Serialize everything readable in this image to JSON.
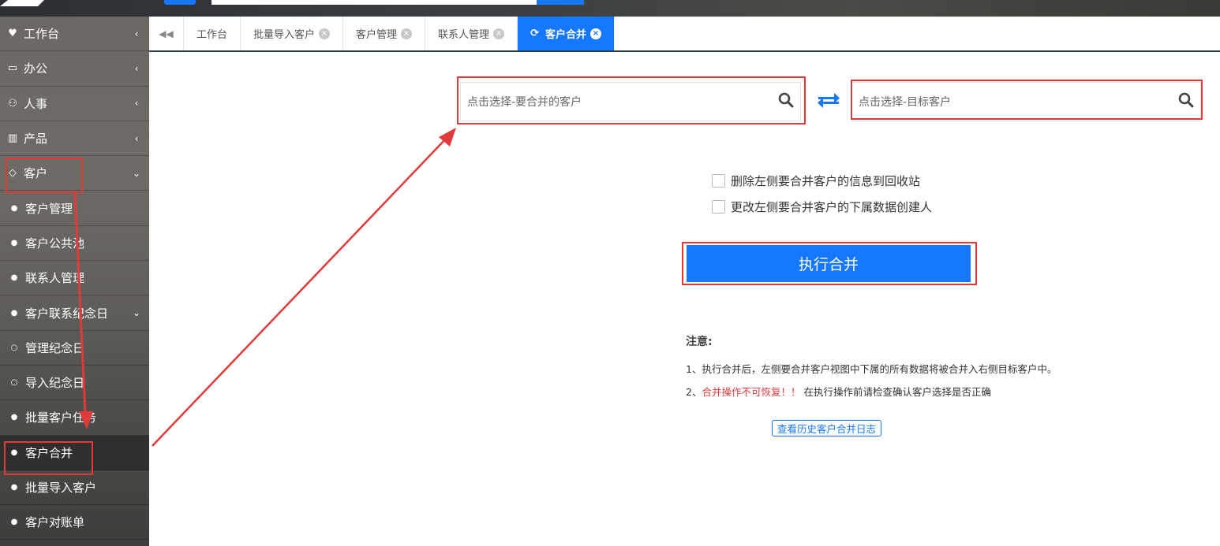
{
  "sidebar": {
    "items": [
      {
        "icon": "heart-icon",
        "glyph": "♥",
        "label": "工作台",
        "chev": "‹"
      },
      {
        "icon": "laptop-icon",
        "glyph": "▭",
        "label": "办公",
        "chev": "‹"
      },
      {
        "icon": "users-icon",
        "glyph": "⚇",
        "label": "人事",
        "chev": "‹"
      },
      {
        "icon": "barcode-icon",
        "glyph": "▥",
        "label": "产品",
        "chev": "‹"
      },
      {
        "icon": "diamond-icon",
        "glyph": "◇",
        "label": "客户",
        "chev": "⌄"
      },
      {
        "icon": "dot-icon",
        "glyph": "●",
        "label": "客户管理",
        "chev": ""
      },
      {
        "icon": "dot-icon",
        "glyph": "●",
        "label": "客户公共池",
        "chev": ""
      },
      {
        "icon": "dot-icon",
        "glyph": "●",
        "label": "联系人管理",
        "chev": ""
      },
      {
        "icon": "dot-icon",
        "glyph": "●",
        "label": "客户联系纪念日",
        "chev": "⌄"
      },
      {
        "icon": "circle-icon",
        "glyph": "○",
        "label": "管理纪念日",
        "chev": ""
      },
      {
        "icon": "circle-icon",
        "glyph": "○",
        "label": "导入纪念日",
        "chev": ""
      },
      {
        "icon": "dot-icon",
        "glyph": "●",
        "label": "批量客户任务",
        "chev": ""
      },
      {
        "icon": "dot-icon",
        "glyph": "●",
        "label": "客户合并",
        "chev": ""
      },
      {
        "icon": "dot-icon",
        "glyph": "●",
        "label": "批量导入客户",
        "chev": ""
      },
      {
        "icon": "dot-icon",
        "glyph": "●",
        "label": "客户对账单",
        "chev": ""
      }
    ]
  },
  "tabs": {
    "back_glyph": "◀◀",
    "items": [
      {
        "label": "工作台",
        "closable": false
      },
      {
        "label": "批量导入客户",
        "closable": true
      },
      {
        "label": "客户管理",
        "closable": true
      },
      {
        "label": "联系人管理",
        "closable": true
      },
      {
        "label": "客户合并",
        "closable": true
      }
    ],
    "close_glyph": "×",
    "refresh_glyph": "⟳"
  },
  "merge": {
    "source_placeholder": "点击选择-要合并的客户",
    "target_placeholder": "点击选择-目标客户",
    "option_delete": "删除左侧要合并客户的信息到回收站",
    "option_change_creator": "更改左侧要合并客户的下属数据创建人",
    "execute_label": "执行合并"
  },
  "notes": {
    "title": "注意:",
    "line1": "1、执行合并后，左侧要合并客户视图中下属的所有数据将被合并入右侧目标客户中。",
    "line2_prefix": "2、",
    "line2_red": "合并操作不可恢复！！",
    "line2_suffix": " 在执行操作前请检查确认客户选择是否正确",
    "history_link": "查看历史客户合并日志"
  },
  "colors": {
    "accent": "#1677ff",
    "annotation": "#e03a3a",
    "warning_text": "#e03a3a"
  }
}
